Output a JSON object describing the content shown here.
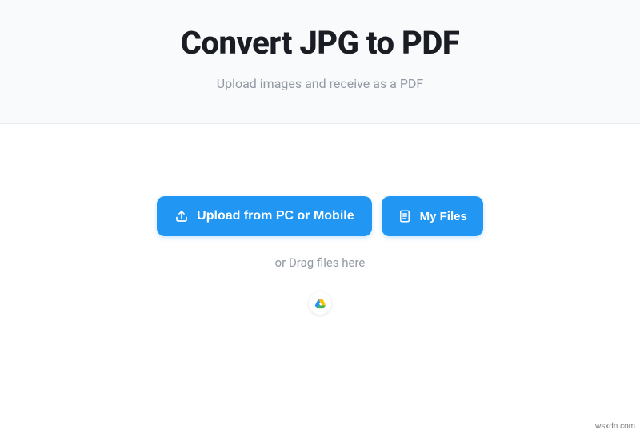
{
  "header": {
    "title": "Convert JPG to PDF",
    "subtitle": "Upload images and receive as a PDF"
  },
  "actions": {
    "upload_label": "Upload from PC or Mobile",
    "myfiles_label": "My Files",
    "drag_text": "or Drag files here"
  },
  "icons": {
    "upload": "upload-icon",
    "files": "files-icon",
    "drive": "google-drive-icon"
  },
  "colors": {
    "primary": "#2196f3",
    "header_bg": "#f9fafc",
    "text_dark": "#1a1d23",
    "text_muted": "#9299a3"
  },
  "watermark": "wsxdn.com"
}
